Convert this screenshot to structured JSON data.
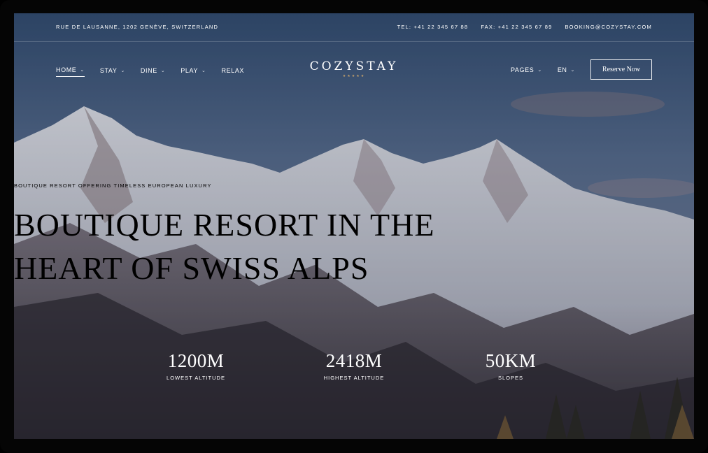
{
  "topbar": {
    "address": "RUE DE LAUSANNE, 1202 GENÈVE, SWITZERLAND",
    "tel": "TEL: +41 22 345 67 88",
    "fax": "FAX: +41 22 345 67 89",
    "email": "BOOKING@COZYSTAY.COM"
  },
  "nav": {
    "items": [
      {
        "label": "HOME",
        "has_dropdown": true,
        "active": true
      },
      {
        "label": "STAY",
        "has_dropdown": true
      },
      {
        "label": "DINE",
        "has_dropdown": true
      },
      {
        "label": "PLAY",
        "has_dropdown": true
      },
      {
        "label": "RELAX",
        "has_dropdown": false
      }
    ],
    "right": {
      "pages": "PAGES",
      "language": "EN",
      "reserve": "Reserve Now"
    }
  },
  "logo": {
    "name": "COZYSTAY",
    "stars": "★★★★★",
    "star_color": "#c8a36b"
  },
  "hero": {
    "eyebrow": "BOUTIQUE RESORT OFFERING TIMELESS EUROPEAN LUXURY",
    "headline_line1": "BOUTIQUE RESORT IN THE",
    "headline_line2": "HEART OF SWISS ALPS"
  },
  "stats": [
    {
      "value": "1200M",
      "label": "LOWEST ALTITUDE"
    },
    {
      "value": "2418M",
      "label": "HIGHEST ALTITUDE"
    },
    {
      "value": "50KM",
      "label": "SLOPES"
    }
  ],
  "icons": {
    "dropdown": "chevron-down-icon"
  }
}
